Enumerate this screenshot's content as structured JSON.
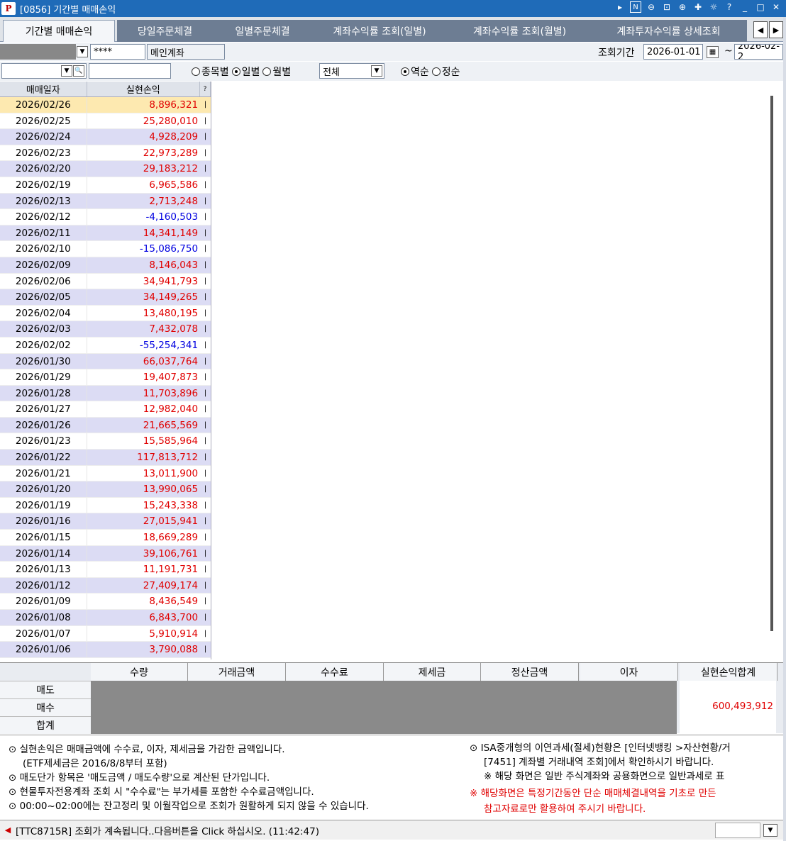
{
  "window": {
    "logo": "P",
    "title": "[0856] 기간별 매매손익",
    "tools": [
      "N"
    ]
  },
  "tabs": [
    {
      "label": "기간별 매매손익"
    },
    {
      "label": "당일주문체결"
    },
    {
      "label": "일별주문체결"
    },
    {
      "label": "계좌수익률 조회(일별)"
    },
    {
      "label": "계좌수익률 조회(월별)"
    },
    {
      "label": "계좌투자수익률 상세조회"
    }
  ],
  "account": {
    "password": "****",
    "account_name": "메인계좌",
    "period_label": "조회기간",
    "date_from": "2026-01-01",
    "date_sep": "~",
    "date_to": "2026-02-2"
  },
  "filter": {
    "search_value": "",
    "radio_by_stock": "종목별",
    "radio_daily": "일별",
    "radio_monthly": "월별",
    "category": "전체",
    "radio_desc": "역순",
    "radio_asc": "정순"
  },
  "grid": {
    "headers": [
      "매매일자",
      "실현손익",
      "?"
    ],
    "rows": [
      {
        "date": "2026/02/26",
        "amount": "8,896,321",
        "sign": "pos"
      },
      {
        "date": "2026/02/25",
        "amount": "25,280,010",
        "sign": "pos"
      },
      {
        "date": "2026/02/24",
        "amount": "4,928,209",
        "sign": "pos"
      },
      {
        "date": "2026/02/23",
        "amount": "22,973,289",
        "sign": "pos"
      },
      {
        "date": "2026/02/20",
        "amount": "29,183,212",
        "sign": "pos"
      },
      {
        "date": "2026/02/19",
        "amount": "6,965,586",
        "sign": "pos"
      },
      {
        "date": "2026/02/13",
        "amount": "2,713,248",
        "sign": "pos"
      },
      {
        "date": "2026/02/12",
        "amount": "-4,160,503",
        "sign": "neg"
      },
      {
        "date": "2026/02/11",
        "amount": "14,341,149",
        "sign": "pos"
      },
      {
        "date": "2026/02/10",
        "amount": "-15,086,750",
        "sign": "neg"
      },
      {
        "date": "2026/02/09",
        "amount": "8,146,043",
        "sign": "pos"
      },
      {
        "date": "2026/02/06",
        "amount": "34,941,793",
        "sign": "pos"
      },
      {
        "date": "2026/02/05",
        "amount": "34,149,265",
        "sign": "pos"
      },
      {
        "date": "2026/02/04",
        "amount": "13,480,195",
        "sign": "pos"
      },
      {
        "date": "2026/02/03",
        "amount": "7,432,078",
        "sign": "pos"
      },
      {
        "date": "2026/02/02",
        "amount": "-55,254,341",
        "sign": "neg"
      },
      {
        "date": "2026/01/30",
        "amount": "66,037,764",
        "sign": "pos"
      },
      {
        "date": "2026/01/29",
        "amount": "19,407,873",
        "sign": "pos"
      },
      {
        "date": "2026/01/28",
        "amount": "11,703,896",
        "sign": "pos"
      },
      {
        "date": "2026/01/27",
        "amount": "12,982,040",
        "sign": "pos"
      },
      {
        "date": "2026/01/26",
        "amount": "21,665,569",
        "sign": "pos"
      },
      {
        "date": "2026/01/23",
        "amount": "15,585,964",
        "sign": "pos"
      },
      {
        "date": "2026/01/22",
        "amount": "117,813,712",
        "sign": "pos"
      },
      {
        "date": "2026/01/21",
        "amount": "13,011,900",
        "sign": "pos"
      },
      {
        "date": "2026/01/20",
        "amount": "13,990,065",
        "sign": "pos"
      },
      {
        "date": "2026/01/19",
        "amount": "15,243,338",
        "sign": "pos"
      },
      {
        "date": "2026/01/16",
        "amount": "27,015,941",
        "sign": "pos"
      },
      {
        "date": "2026/01/15",
        "amount": "18,669,289",
        "sign": "pos"
      },
      {
        "date": "2026/01/14",
        "amount": "39,106,761",
        "sign": "pos"
      },
      {
        "date": "2026/01/13",
        "amount": "11,191,731",
        "sign": "pos"
      },
      {
        "date": "2026/01/12",
        "amount": "27,409,174",
        "sign": "pos"
      },
      {
        "date": "2026/01/09",
        "amount": "8,436,549",
        "sign": "pos"
      },
      {
        "date": "2026/01/08",
        "amount": "6,843,700",
        "sign": "pos"
      },
      {
        "date": "2026/01/07",
        "amount": "5,910,914",
        "sign": "pos"
      },
      {
        "date": "2026/01/06",
        "amount": "3,790,088",
        "sign": "pos"
      }
    ]
  },
  "summary": {
    "headers": [
      "수량",
      "거래금액",
      "수수료",
      "제세금",
      "정산금액",
      "이자",
      "실현손익합계"
    ],
    "row_labels": [
      "매도",
      "매수",
      "합계"
    ],
    "total": "600,493,912"
  },
  "notes": {
    "left": [
      "⊙ 실현손익은 매매금액에 수수료, 이자, 제세금을 가감한 금액입니다.",
      "(ETF제세금은 2016/8/8부터 포함)",
      "⊙ 매도단가 항목은 '매도금액 / 매도수량'으로 계산된 단가입니다.",
      "⊙ 현물투자전용계좌 조회 시 \"수수료\"는 부가세를 포함한 수수료금액입니다.",
      "⊙ 00:00~02:00에는 잔고정리 및 이월작업으로 조회가 원활하게 되지 않을 수 있습니다."
    ],
    "right": [
      "⊙ ISA중개형의 이연과세(절세)현황은 [인터넷뱅킹 >자산현황/거",
      "[7451] 계좌별 거래내역 조회]에서 확인하시기 바랍니다.",
      "※ 해당 화면은 일반 주식계좌와 공용화면으로 일반과세로 표"
    ],
    "warning": [
      "※ 해당화면은 특정기간동안 단순 매매체결내역을 기초로 만든",
      "참고자료로만 활용하여 주시기 바랍니다."
    ]
  },
  "status": {
    "message": "[TTC8715R] 조회가 계속됩니다..다음버튼을 Click 하십시오. (11:42:47)"
  }
}
